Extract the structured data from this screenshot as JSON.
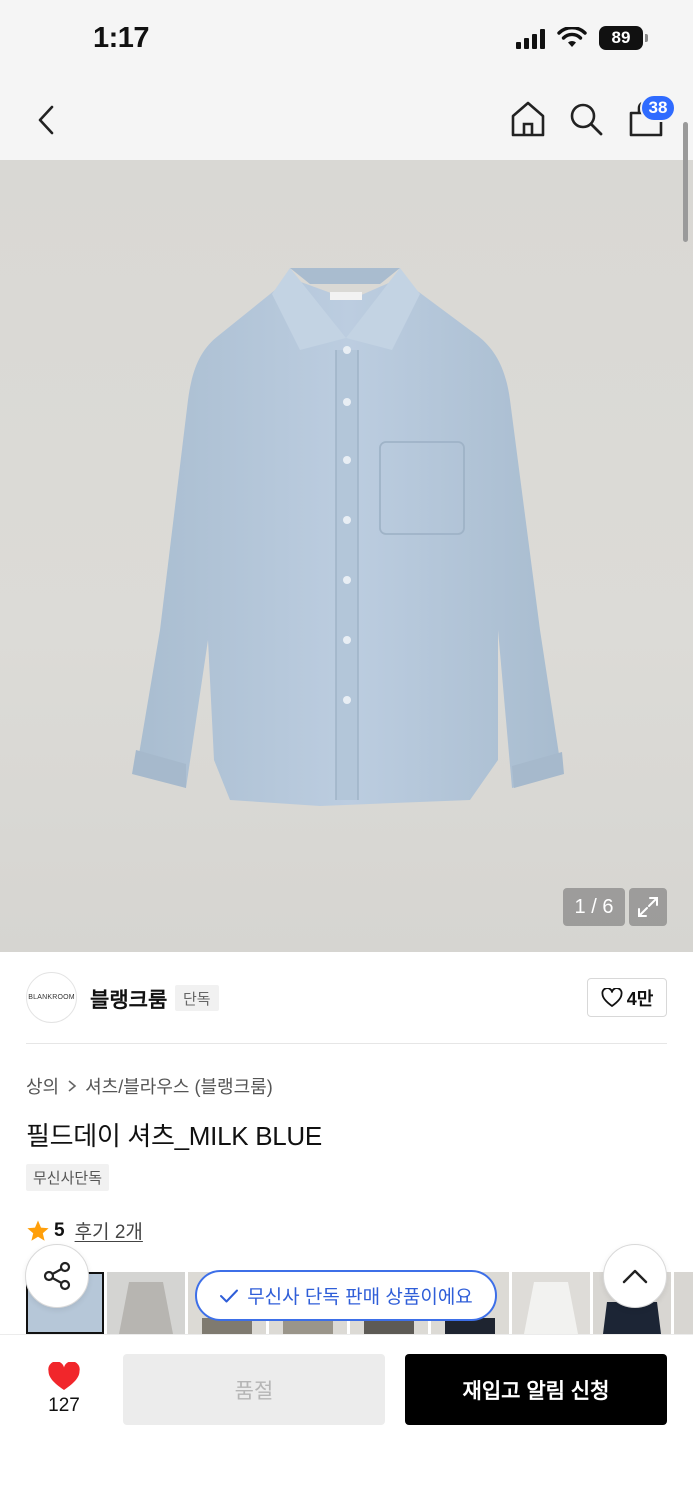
{
  "status_bar": {
    "time": "1:17",
    "battery": "89"
  },
  "nav": {
    "cart_count": "38"
  },
  "gallery": {
    "counter": "1 / 6",
    "shirt_color": "#b7c9d9"
  },
  "brand": {
    "logo_text": "BLANKROOM",
    "name": "블랭크룸",
    "tag": "단독",
    "likes": "4만"
  },
  "product": {
    "breadcrumb": [
      "상의",
      "셔츠/블라우스 (블랭크룸)"
    ],
    "title": "필드데이 셔츠_MILK BLUE",
    "exclusive_tag": "무신사단독",
    "rating": "5",
    "review_link": "후기 2개"
  },
  "exclusive_notice": "무신사 단독 판매 상품이에요",
  "bottom_bar": {
    "like_count": "127",
    "sold_out_label": "품절",
    "restock_label": "재입고 알림 신청"
  },
  "colors": {
    "accent_blue": "#2f6bff",
    "heart_red": "#f1262b",
    "star_orange": "#ff9f0a"
  }
}
